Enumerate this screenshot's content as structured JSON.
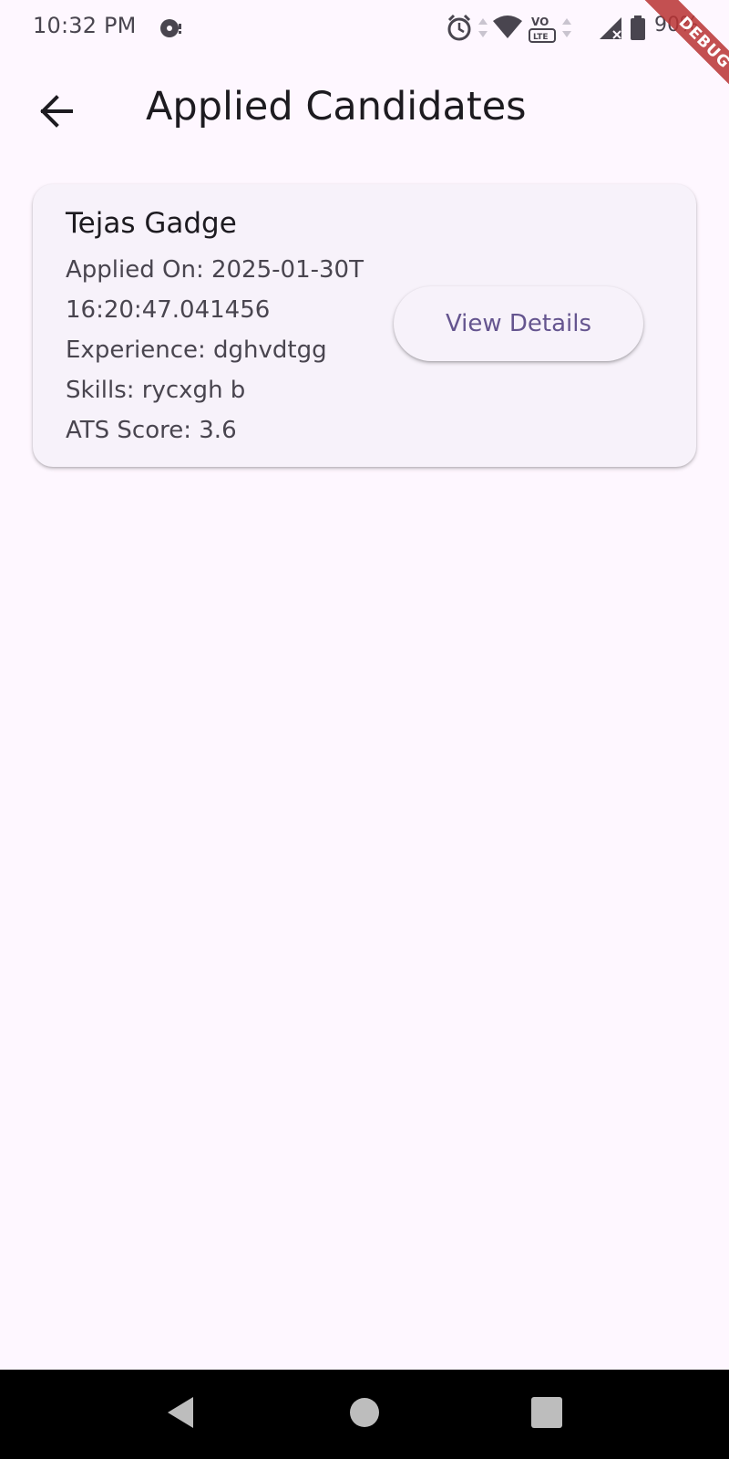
{
  "status_bar": {
    "time": "10:32 PM",
    "battery_percent": "90%",
    "icons": [
      "notification-icon",
      "alarm-icon",
      "wifi-icon",
      "volte-icon",
      "signal-icon",
      "battery-icon"
    ],
    "network_label": "LTE",
    "volte_label": "VO"
  },
  "debug_banner": {
    "label": "DEBUG",
    "color": "#B83232"
  },
  "app_bar": {
    "title": "Applied Candidates",
    "back_icon": "back-arrow-icon"
  },
  "candidates": [
    {
      "name": "Tejas Gadge",
      "applied_on": "Applied On: 2025-01-30T16:20:47.041456",
      "experience": "Experience: dghvdtgg",
      "skills": "Skills: rycxgh b",
      "ats_score": "ATS Score: 3.6",
      "action_label": "View Details"
    }
  ],
  "nav_bar": {
    "icons": [
      "back-triangle-icon",
      "home-circle-icon",
      "recents-square-icon"
    ]
  },
  "colors": {
    "background": "#FEF7FF",
    "card": "#F7F2FA",
    "accent": "#65558F",
    "text_primary": "#1D1B20",
    "text_secondary": "#49454F",
    "nav_bar": "#000000"
  }
}
